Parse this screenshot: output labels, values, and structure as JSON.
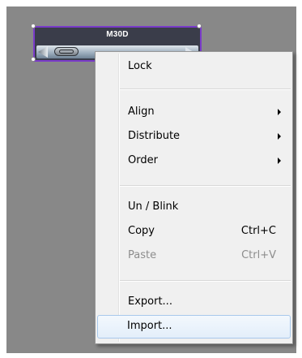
{
  "widget": {
    "title": "M30D"
  },
  "menu": {
    "items": [
      {
        "label": "Lock",
        "shortcut": "",
        "has_submenu": false,
        "enabled": true
      },
      {
        "label": "Align",
        "shortcut": "",
        "has_submenu": true,
        "enabled": true
      },
      {
        "label": "Distribute",
        "shortcut": "",
        "has_submenu": true,
        "enabled": true
      },
      {
        "label": "Order",
        "shortcut": "",
        "has_submenu": true,
        "enabled": true
      },
      {
        "label": "Un / Blink",
        "shortcut": "",
        "has_submenu": false,
        "enabled": true
      },
      {
        "label": "Copy",
        "shortcut": "Ctrl+C",
        "has_submenu": false,
        "enabled": true
      },
      {
        "label": "Paste",
        "shortcut": "Ctrl+V",
        "has_submenu": false,
        "enabled": false
      },
      {
        "label": "Export...",
        "shortcut": "",
        "has_submenu": false,
        "enabled": true
      },
      {
        "label": "Import...",
        "shortcut": "",
        "has_submenu": false,
        "enabled": true,
        "highlighted": true
      }
    ]
  },
  "colors": {
    "selection_border": "#7a3bc9",
    "canvas_bg": "#888888",
    "menu_bg": "#f0f0f0",
    "highlight_border": "#a8c8eb"
  }
}
